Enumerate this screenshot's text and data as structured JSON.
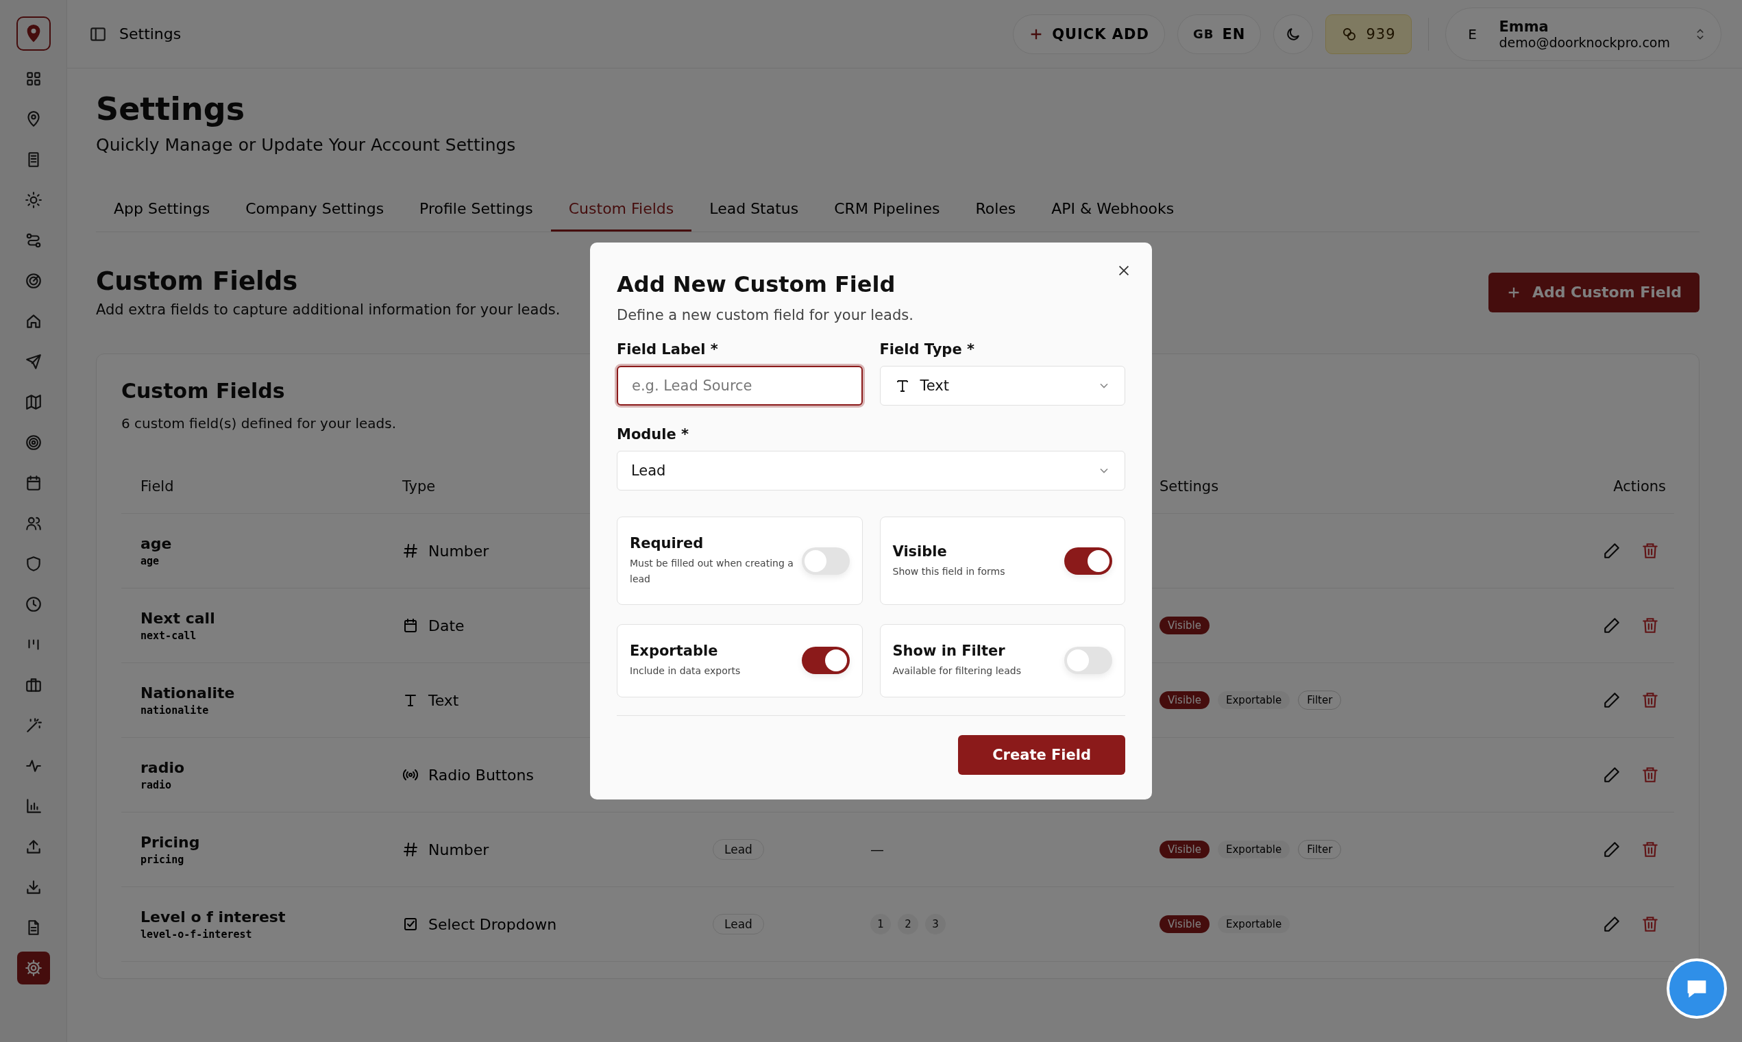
{
  "topbar": {
    "title": "Settings",
    "quick_add": "QUICK ADD",
    "language_flag": "GB",
    "language": "EN",
    "credits": "939",
    "user": {
      "initial": "E",
      "name": "Emma",
      "email": "demo@doorknockpro.com"
    }
  },
  "sidebar": {
    "items": [
      {
        "selected": false
      },
      {
        "selected": false
      },
      {
        "selected": false
      },
      {
        "selected": false
      },
      {
        "selected": false
      },
      {
        "selected": false
      },
      {
        "selected": false
      },
      {
        "selected": false
      },
      {
        "selected": false
      },
      {
        "selected": false
      },
      {
        "selected": false
      },
      {
        "selected": false
      },
      {
        "selected": false
      },
      {
        "selected": false
      },
      {
        "selected": false
      },
      {
        "selected": false
      },
      {
        "selected": false
      },
      {
        "selected": false
      },
      {
        "selected": false
      },
      {
        "selected": false
      },
      {
        "selected": false
      },
      {
        "selected": false
      },
      {
        "selected": true
      }
    ]
  },
  "page": {
    "title": "Settings",
    "subtitle": "Quickly Manage or Update Your Account Settings",
    "tabs": [
      {
        "label": "App Settings",
        "selected": false
      },
      {
        "label": "Company Settings",
        "selected": false
      },
      {
        "label": "Profile Settings",
        "selected": false
      },
      {
        "label": "Custom Fields",
        "selected": true
      },
      {
        "label": "Lead Status",
        "selected": false
      },
      {
        "label": "CRM Pipelines",
        "selected": false
      },
      {
        "label": "Roles",
        "selected": false
      },
      {
        "label": "API & Webhooks",
        "selected": false
      }
    ]
  },
  "section": {
    "title": "Custom Fields",
    "subtitle": "Add extra fields to capture additional information for your leads.",
    "add_button": "Add Custom Field"
  },
  "card": {
    "title": "Custom Fields",
    "subtitle": "6 custom field(s) defined for your leads.",
    "columns": {
      "field": "Field",
      "type": "Type",
      "settings": "Settings",
      "actions": "Actions"
    },
    "rows": [
      {
        "name": "age",
        "key": "age",
        "type": "Number",
        "kind": "number",
        "tags": []
      },
      {
        "name": "Next call",
        "key": "next-call",
        "type": "Date",
        "kind": "date",
        "tags": [
          {
            "label": "Visible",
            "kind": "primary"
          }
        ]
      },
      {
        "name": "Nationalite",
        "key": "nationalite",
        "type": "Text",
        "kind": "text",
        "tags": [
          {
            "label": "Visible",
            "kind": "primary"
          },
          {
            "label": "Exportable",
            "kind": "soft"
          },
          {
            "label": "Filter",
            "kind": "outline"
          }
        ]
      },
      {
        "name": "radio",
        "key": "radio",
        "type": "Radio Buttons",
        "kind": "radio",
        "tags": []
      },
      {
        "name": "Pricing",
        "key": "pricing",
        "type": "Number",
        "kind": "number",
        "module": "Lead",
        "options_text": "—",
        "tags": [
          {
            "label": "Visible",
            "kind": "primary"
          },
          {
            "label": "Exportable",
            "kind": "soft"
          },
          {
            "label": "Filter",
            "kind": "outline"
          }
        ]
      },
      {
        "name": "Level o f interest",
        "key": "level-o-f-interest",
        "type": "Select Dropdown",
        "kind": "select",
        "module": "Lead",
        "options": [
          "1",
          "2",
          "3"
        ],
        "tags": [
          {
            "label": "Visible",
            "kind": "primary"
          },
          {
            "label": "Exportable",
            "kind": "soft"
          }
        ]
      }
    ]
  },
  "modal": {
    "title": "Add New Custom Field",
    "subtitle": "Define a new custom field for your leads.",
    "field_label": {
      "label": "Field Label *",
      "placeholder": "e.g. Lead Source"
    },
    "field_type": {
      "label": "Field Type *",
      "value": "Text"
    },
    "module": {
      "label": "Module *",
      "value": "Lead"
    },
    "toggles": [
      {
        "title": "Required",
        "description": "Must be filled out when creating a lead",
        "on": false
      },
      {
        "title": "Visible",
        "description": "Show this field in forms",
        "on": true
      },
      {
        "title": "Exportable",
        "description": "Include in data exports",
        "on": true
      },
      {
        "title": "Show in Filter",
        "description": "Available for filtering leads",
        "on": false
      }
    ],
    "submit": "Create Field"
  }
}
